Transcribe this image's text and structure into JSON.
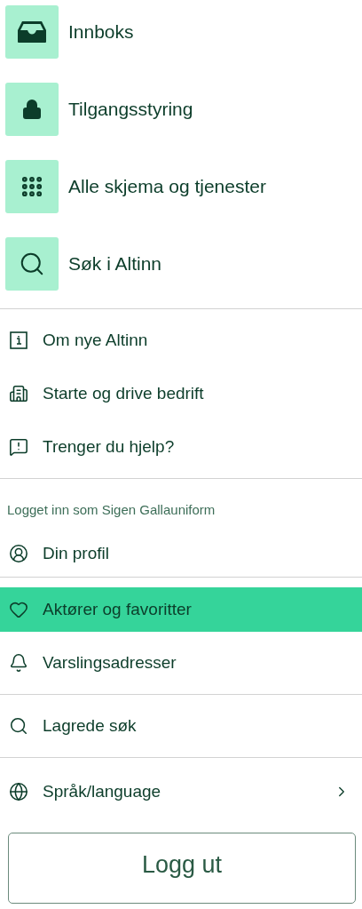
{
  "main_menu": [
    {
      "label": "Innboks",
      "selected": false
    },
    {
      "label": "Tilgangsstyring",
      "selected": false
    },
    {
      "label": "Alle skjema og tjenester",
      "selected": false
    },
    {
      "label": "Søk i Altinn",
      "selected": false
    }
  ],
  "info_links": [
    {
      "label": "Om nye Altinn",
      "selected": false
    },
    {
      "label": "Starte og drive bedrift",
      "selected": false
    },
    {
      "label": "Trenger du hjelp?",
      "selected": false
    }
  ],
  "account": {
    "logged_in_as": "Logget inn som Sigen Gallauniform",
    "items": [
      {
        "label": "Din profil",
        "selected": false
      }
    ]
  },
  "favorites": [
    {
      "label": "Aktører og favoritter",
      "selected": true
    },
    {
      "label": "Varslingsadresser",
      "selected": false
    }
  ],
  "saved": [
    {
      "label": "Lagrede søk",
      "selected": false
    }
  ],
  "language": {
    "label": "Språk/language"
  },
  "logout_button": "Logg ut"
}
